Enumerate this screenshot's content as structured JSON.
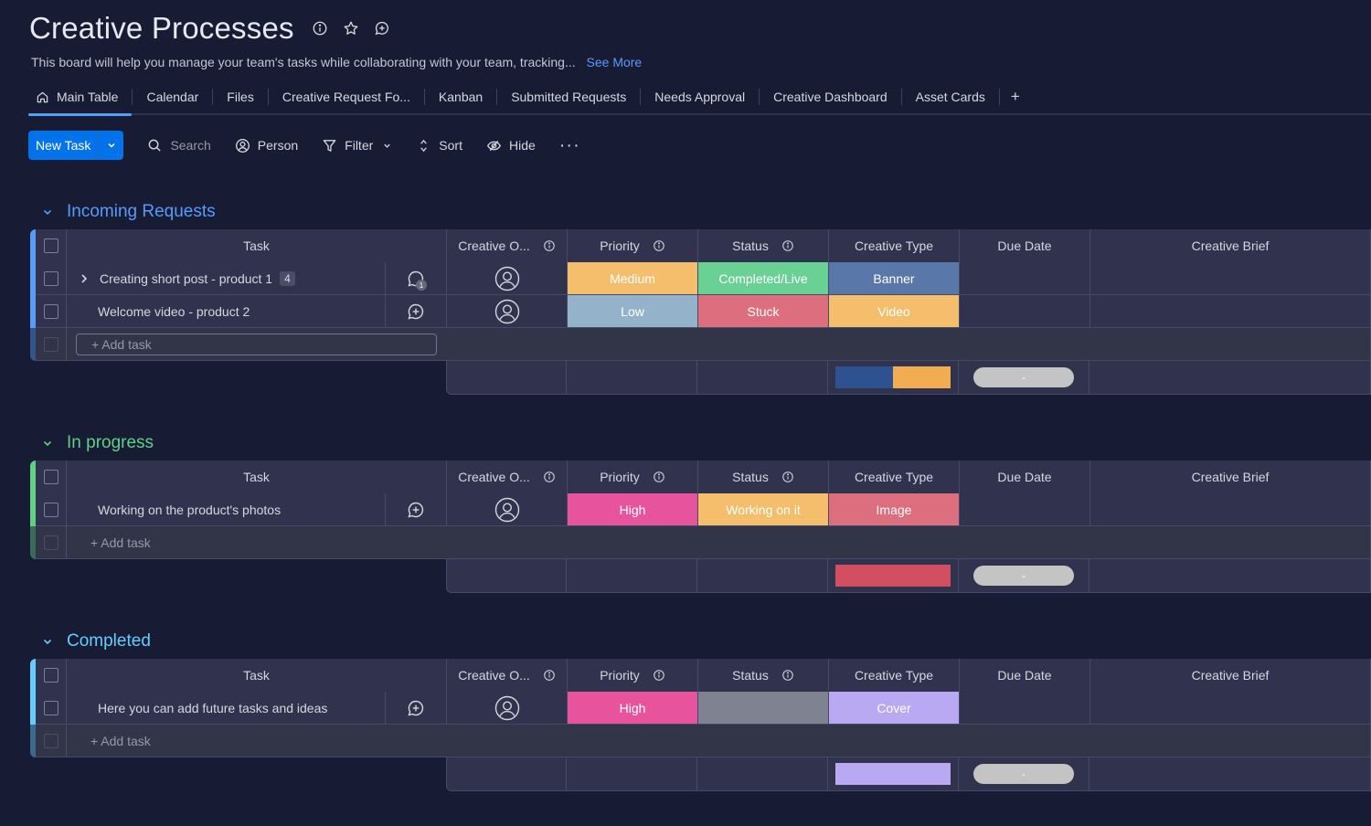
{
  "board": {
    "title": "Creative Processes",
    "description": "This board will help you manage your team's tasks while collaborating with your team, tracking...",
    "see_more": "See More",
    "title_icons": [
      "info-icon",
      "star-icon",
      "add-update-icon"
    ]
  },
  "tabs": [
    {
      "label": "Main Table",
      "active": true,
      "icon": "home-icon"
    },
    {
      "label": "Calendar"
    },
    {
      "label": "Files"
    },
    {
      "label": "Creative Request Fo..."
    },
    {
      "label": "Kanban"
    },
    {
      "label": "Submitted Requests"
    },
    {
      "label": "Needs Approval"
    },
    {
      "label": "Creative Dashboard"
    },
    {
      "label": "Asset Cards"
    },
    {
      "label": "+"
    }
  ],
  "toolbar": {
    "new_task": "New Task",
    "search": "Search",
    "person": "Person",
    "filter": "Filter",
    "sort": "Sort",
    "hide": "Hide",
    "more": "···"
  },
  "columns": {
    "task": "Task",
    "owner": "Creative O...",
    "priority": "Priority",
    "status": "Status",
    "type": "Creative Type",
    "due": "Due Date",
    "brief": "Creative Brief"
  },
  "add_task_label": "+ Add task",
  "colors": {
    "accent": "#0073ea",
    "medium": "#fdbc64",
    "low": "#9ab6cc",
    "high": "#e8509c",
    "completed_live": "#6ad195",
    "stuck": "#e07386",
    "working_on_it": "#f4be6c",
    "empty_status": "#7f8291",
    "banner": "#5a77aa",
    "video": "#f4be6c",
    "image": "#de7382",
    "cover": "#b9a9f2"
  },
  "groups": [
    {
      "title": "Incoming Requests",
      "color": "#579bfc",
      "add_row_style": "input",
      "rows": [
        {
          "task": "Creating short post - product 1",
          "has_subitems": true,
          "subitem_count": "4",
          "updates": "1",
          "priority": {
            "label": "Medium",
            "color": "#f4be6c"
          },
          "status": {
            "label": "Completed/Live",
            "color": "#6ad195"
          },
          "type": {
            "label": "Banner",
            "color": "#5a77aa"
          }
        },
        {
          "task": "Welcome video - product 2",
          "has_subitems": false,
          "updates": "",
          "priority": {
            "label": "Low",
            "color": "#94b3cb"
          },
          "status": {
            "label": "Stuck",
            "color": "#dc6e7d"
          },
          "type": {
            "label": "Video",
            "color": "#f4be6c"
          }
        }
      ],
      "summary": {
        "type_segments": [
          {
            "color": "#2e5190",
            "fraction": 0.5
          },
          {
            "color": "#f2ad52",
            "fraction": 0.5
          }
        ],
        "due": "-"
      }
    },
    {
      "title": "In progress",
      "color": "#5fd185",
      "add_row_style": "plain",
      "rows": [
        {
          "task": "Working on the product's photos",
          "has_subitems": false,
          "updates": "",
          "priority": {
            "label": "High",
            "color": "#e8539e"
          },
          "status": {
            "label": "Working on it",
            "color": "#f4be6c"
          },
          "type": {
            "label": "Image",
            "color": "#dc6e7d"
          }
        }
      ],
      "summary": {
        "type_segments": [
          {
            "color": "#d14f61",
            "fraction": 1
          }
        ],
        "due": "-"
      }
    },
    {
      "title": "Completed",
      "color": "#66ccff",
      "add_row_style": "plain",
      "rows": [
        {
          "task": "Here you can add future tasks and ideas",
          "has_subitems": false,
          "updates": "",
          "priority": {
            "label": "High",
            "color": "#e8539e"
          },
          "status": {
            "label": "",
            "color": "#7f8291"
          },
          "type": {
            "label": "Cover",
            "color": "#b9a9f2"
          }
        }
      ],
      "summary": {
        "type_segments": [
          {
            "color": "#b9a9f2",
            "fraction": 1
          }
        ],
        "due": "-"
      }
    }
  ]
}
